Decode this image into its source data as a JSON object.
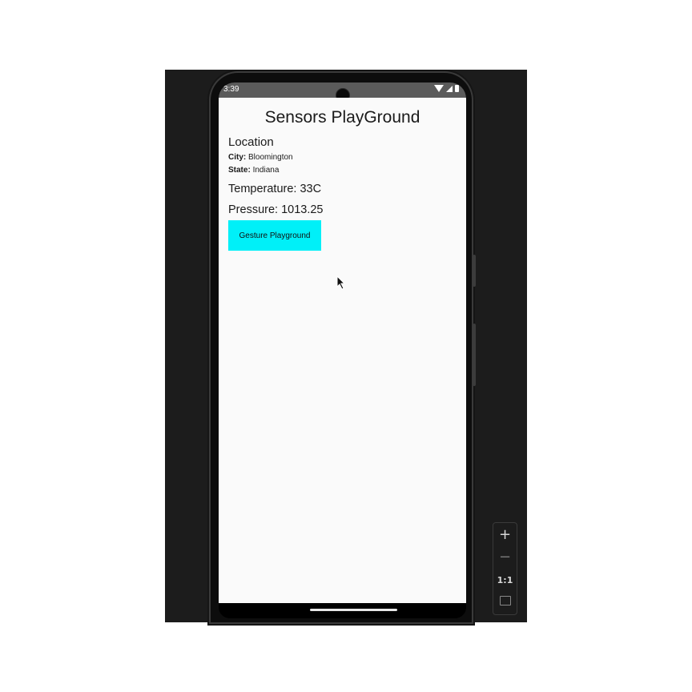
{
  "status_bar": {
    "time": "3:39",
    "icons": [
      "wifi-icon",
      "signal-icon",
      "battery-icon"
    ]
  },
  "app": {
    "title": "Sensors PlayGround",
    "location": {
      "heading": "Location",
      "city_label": "City:",
      "city_value": "Bloomington",
      "state_label": "State:",
      "state_value": "Indiana"
    },
    "temperature": "Temperature: 33C",
    "pressure": "Pressure: 1013.25",
    "gesture_button_label": "Gesture Playground",
    "colors": {
      "button_bg": "#00f0f8",
      "app_bg": "#fafafa",
      "status_bar": "#5b5b5b"
    }
  },
  "emulator_controls": {
    "zoom_in": "+",
    "zoom_out": "−",
    "actual_size": "1:1",
    "fit_icon": "fit-screen-icon"
  }
}
